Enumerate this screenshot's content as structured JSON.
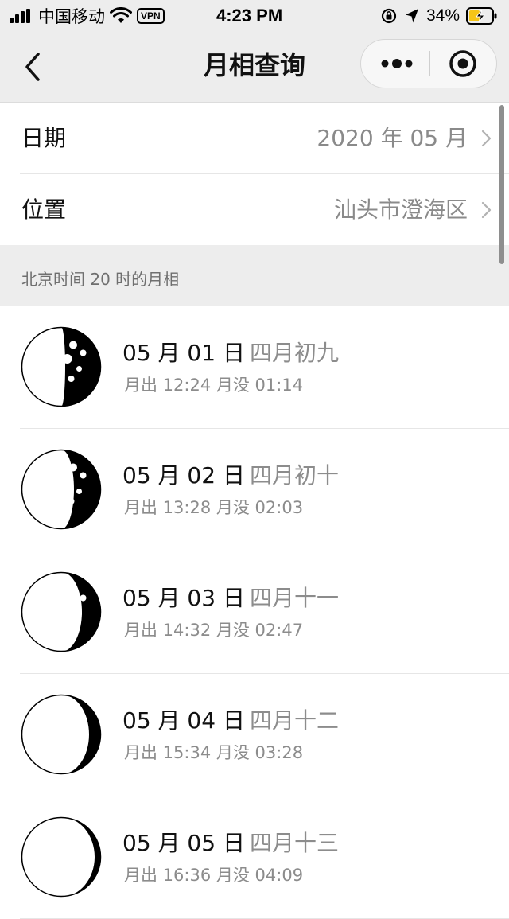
{
  "status_bar": {
    "carrier": "中国移动",
    "vpn": "VPN",
    "time": "4:23 PM",
    "battery": "34%"
  },
  "nav": {
    "title": "月相查询"
  },
  "settings": {
    "date_label": "日期",
    "date_value": "2020 年 05 月",
    "location_label": "位置",
    "location_value": "汕头市澄海区"
  },
  "section_header": "北京时间 20 时的月相",
  "moon_days": [
    {
      "date": "05 月 01 日",
      "lunar": "四月初九",
      "times": "月出 12:24 月没 01:14",
      "illumination": 0.55
    },
    {
      "date": "05 月 02 日",
      "lunar": "四月初十",
      "times": "月出 13:28 月没 02:03",
      "illumination": 0.66
    },
    {
      "date": "05 月 03 日",
      "lunar": "四月十一",
      "times": "月出 14:32 月没 02:47",
      "illumination": 0.76
    },
    {
      "date": "05 月 04 日",
      "lunar": "四月十二",
      "times": "月出 15:34 月没 03:28",
      "illumination": 0.85
    },
    {
      "date": "05 月 05 日",
      "lunar": "四月十三",
      "times": "月出 16:36 月没 04:09",
      "illumination": 0.92
    }
  ],
  "colors": {
    "chrome_background": "#ededed",
    "primary_text": "#111111",
    "secondary_text": "#8c8c8c",
    "divider": "#e6e6e6"
  },
  "icons": {
    "back": "chevron-left-icon",
    "more": "more-dots-icon",
    "close": "target-circle-icon",
    "row_arrow": "chevron-right-icon"
  }
}
